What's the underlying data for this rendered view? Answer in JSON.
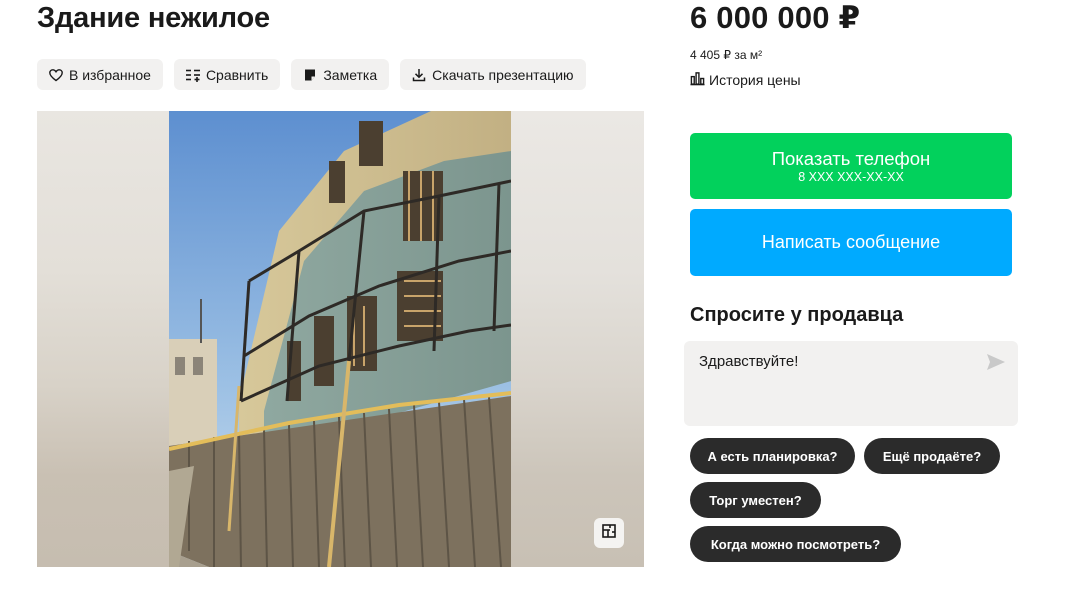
{
  "listing": {
    "title": "Здание нежилое",
    "actions": [
      {
        "label": "В избранное",
        "icon": "heart-icon"
      },
      {
        "label": "Сравнить",
        "icon": "compare-icon"
      },
      {
        "label": "Заметка",
        "icon": "note-icon"
      },
      {
        "label": "Скачать презентацию",
        "icon": "download-icon"
      }
    ],
    "gallery": {
      "plan_icon": "floor-plan-icon"
    }
  },
  "sidebar": {
    "price": "6 000 000 ₽",
    "price_per_m2": "4 405 ₽ за м²",
    "history_label": "История цены",
    "history_icon": "bar-chart-icon",
    "phone_button": {
      "label": "Показать телефон",
      "sublabel": "8 XXX XXX-XX-XX",
      "color": "#02d15c"
    },
    "message_button": {
      "label": "Написать сообщение",
      "color": "#00aaff"
    }
  },
  "ask": {
    "title": "Спросите у продавца",
    "message_text": "Здравствуйте!",
    "send_icon": "send-icon",
    "chips": [
      "А есть планировка?",
      "Ещё продаёте?",
      "Торг уместен?",
      "Когда можно посмотреть?"
    ]
  }
}
